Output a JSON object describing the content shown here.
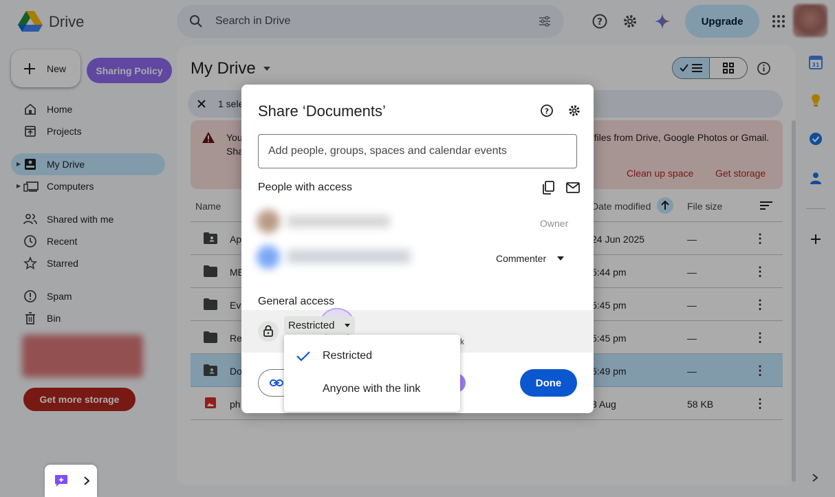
{
  "app": {
    "name": "Drive"
  },
  "search": {
    "placeholder": "Search in Drive"
  },
  "header": {
    "upgrade_label": "Upgrade"
  },
  "sidebar": {
    "new_label": "New",
    "policy_label": "Sharing Policy",
    "items": [
      {
        "label": "Home"
      },
      {
        "label": "Projects"
      },
      {
        "label": "My Drive"
      },
      {
        "label": "Computers"
      },
      {
        "label": "Shared with me"
      },
      {
        "label": "Recent"
      },
      {
        "label": "Starred"
      },
      {
        "label": "Spam"
      },
      {
        "label": "Bin"
      }
    ],
    "storage_button": "Get more storage"
  },
  "main": {
    "title": "My Drive",
    "selection_text": "1 sele",
    "warning": {
      "text_left_1": "You",
      "text_left_2": "Sha",
      "text_right": "files from Drive, Google Photos or Gmail.",
      "link_cleanup": "Clean up space",
      "link_storage": "Get storage"
    },
    "columns": {
      "name": "Name",
      "date": "Date modified",
      "size": "File size"
    },
    "rows": [
      {
        "name": "Ap",
        "date": "24 Jun 2025",
        "size": "—"
      },
      {
        "name": "ME",
        "date": "5:44 pm",
        "size": "—"
      },
      {
        "name": "Eva",
        "date": "5:45 pm",
        "size": "—"
      },
      {
        "name": "Re",
        "date": "5:45 pm",
        "size": "—"
      },
      {
        "name": "Do",
        "date": "5:49 pm",
        "size": "—"
      },
      {
        "name": "ph",
        "date": "3 Aug",
        "size": "58 KB"
      }
    ]
  },
  "dialog": {
    "title": "Share ‘Documents’",
    "add_placeholder": "Add people, groups, spaces and calendar events",
    "people_heading": "People with access",
    "owner_role": "Owner",
    "second_role": "Commenter",
    "general_heading": "General access",
    "access_value": "Restricted",
    "hint_tail": "k",
    "done_label": "Done"
  },
  "dropdown": {
    "options": [
      {
        "label": "Restricted",
        "selected": true
      },
      {
        "label": "Anyone with the link",
        "selected": false
      }
    ]
  },
  "colors": {
    "accent": "#0b57d0",
    "selection": "#c2e7ff",
    "warning": "#f9dedc",
    "policy": "#8e6bf2",
    "storage": "#b3261e"
  }
}
